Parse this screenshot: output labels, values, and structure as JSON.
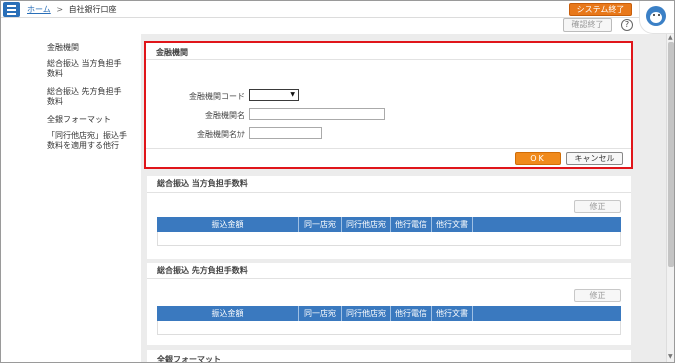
{
  "header": {
    "home_link": "ホーム",
    "separator": ">",
    "page_title": "自社銀行口座",
    "system_end_button": "システム終了",
    "confirm_end_button": "確認終了",
    "help_icon_text": "?"
  },
  "sidebar": {
    "items": [
      {
        "label": "金融機関"
      },
      {
        "label": "総合振込 当方負担手数料"
      },
      {
        "label": "総合振込 先方負担手数料"
      },
      {
        "label": "全銀フォーマット"
      },
      {
        "label": "「同行他店宛」振込手数料を適用する他行"
      }
    ]
  },
  "financial_institution": {
    "title": "金融機関",
    "code_label": "金融機関コード",
    "code_value": "",
    "name_label": "金融機関名",
    "name_value": "",
    "kana_label": "金融機関名ｶﾅ",
    "kana_value": "",
    "ok_button": "OK",
    "cancel_button": "キャンセル"
  },
  "fee_our_side": {
    "title": "総合振込 当方負担手数料",
    "edit_button": "修正",
    "columns": [
      "振込金額",
      "同一店宛",
      "同行他店宛",
      "他行電信",
      "他行文書"
    ]
  },
  "fee_their_side": {
    "title": "総合振込 先方負担手数料",
    "edit_button": "修正",
    "columns": [
      "振込金額",
      "同一店宛",
      "同行他店宛",
      "他行電信",
      "他行文書"
    ]
  },
  "zengin": {
    "title": "全銀フォーマット"
  },
  "colors": {
    "accent_blue": "#3a79bf",
    "orange": "#e8781a",
    "highlight_red": "#e0151a"
  },
  "icons": [
    "menu-icon",
    "help-icon",
    "mascot-icon",
    "dropdown-caret-icon"
  ]
}
